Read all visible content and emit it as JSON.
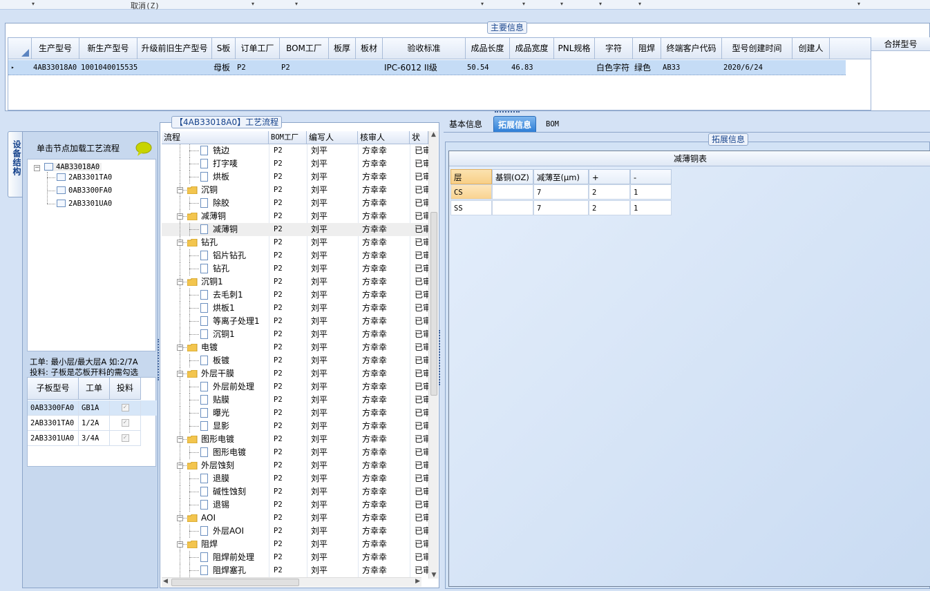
{
  "toolbar": {
    "cancel_label": "取消(Z)"
  },
  "main_info": {
    "title": "主要信息",
    "columns": [
      "生产型号",
      "新生产型号",
      "升级前旧生产型号",
      "S板",
      "订单工厂",
      "BOM工厂",
      "板厚",
      "板材",
      "验收标准",
      "成品长度",
      "成品宽度",
      "PNL规格",
      "字符",
      "阻焊",
      "终端客户代码",
      "型号创建时间",
      "创建人"
    ],
    "row": {
      "indicator": "▸",
      "cells": [
        "4AB33018A0",
        "10010400155354",
        "",
        "母板",
        "P2",
        "P2",
        "",
        "",
        "IPC-6012 II级",
        "50.54",
        "46.83",
        "",
        "白色字符",
        "绿色",
        "AB33",
        "2020/6/24",
        ""
      ]
    },
    "merge_header": "合拼型号"
  },
  "side_tab": {
    "label": "设备结构"
  },
  "left_panel": {
    "load_hint": "单击节点加载工艺流程",
    "tree": {
      "root": "4AB33018A0",
      "children": [
        "2AB3301TA0",
        "0AB3300FA0",
        "2AB3301UA0"
      ]
    },
    "note_line1": "工单: 最小层/最大层A 如:2/7A",
    "note_line2": "投料: 子板是芯板开料的需勾选",
    "sub_grid": {
      "headers": [
        "子板型号",
        "工单",
        "投料"
      ],
      "rows": [
        {
          "model": "0AB3300FA0",
          "order": "GB1A",
          "feed": "✓"
        },
        {
          "model": "2AB3301TA0",
          "order": "1/2A",
          "feed": "✓"
        },
        {
          "model": "2AB3301UA0",
          "order": "3/4A",
          "feed": "✓"
        }
      ]
    }
  },
  "flow": {
    "title": "【4AB33018A0】工艺流程",
    "headers": [
      "流程",
      "BOM工厂",
      "编写人",
      "核审人",
      "状"
    ],
    "rows": [
      {
        "name": "铣边",
        "level": 1,
        "factory": "P2",
        "writer": "刘平",
        "reviewer": "方幸幸",
        "status": "已审"
      },
      {
        "name": "打字唛",
        "level": 1,
        "factory": "P2",
        "writer": "刘平",
        "reviewer": "方幸幸",
        "status": "已审"
      },
      {
        "name": "烘板",
        "level": 1,
        "factory": "P2",
        "writer": "刘平",
        "reviewer": "方幸幸",
        "status": "已审"
      },
      {
        "name": "沉铜",
        "level": 0,
        "factory": "P2",
        "writer": "刘平",
        "reviewer": "方幸幸",
        "status": "已审"
      },
      {
        "name": "除胶",
        "level": 1,
        "factory": "P2",
        "writer": "刘平",
        "reviewer": "方幸幸",
        "status": "已审"
      },
      {
        "name": "减薄铜",
        "level": 0,
        "factory": "P2",
        "writer": "刘平",
        "reviewer": "方幸幸",
        "status": "已审"
      },
      {
        "name": "减薄铜",
        "level": 1,
        "factory": "P2",
        "writer": "刘平",
        "reviewer": "方幸幸",
        "status": "已审",
        "selected": true
      },
      {
        "name": "钻孔",
        "level": 0,
        "factory": "P2",
        "writer": "刘平",
        "reviewer": "方幸幸",
        "status": "已审"
      },
      {
        "name": "铝片钻孔",
        "level": 1,
        "factory": "P2",
        "writer": "刘平",
        "reviewer": "方幸幸",
        "status": "已审"
      },
      {
        "name": "钻孔",
        "level": 1,
        "factory": "P2",
        "writer": "刘平",
        "reviewer": "方幸幸",
        "status": "已审"
      },
      {
        "name": "沉铜1",
        "level": 0,
        "factory": "P2",
        "writer": "刘平",
        "reviewer": "方幸幸",
        "status": "已审"
      },
      {
        "name": "去毛刺1",
        "level": 1,
        "factory": "P2",
        "writer": "刘平",
        "reviewer": "方幸幸",
        "status": "已审"
      },
      {
        "name": "烘板1",
        "level": 1,
        "factory": "P2",
        "writer": "刘平",
        "reviewer": "方幸幸",
        "status": "已审"
      },
      {
        "name": "等离子处理1",
        "level": 1,
        "factory": "P2",
        "writer": "刘平",
        "reviewer": "方幸幸",
        "status": "已审"
      },
      {
        "name": "沉铜1",
        "level": 1,
        "factory": "P2",
        "writer": "刘平",
        "reviewer": "方幸幸",
        "status": "已审"
      },
      {
        "name": "电镀",
        "level": 0,
        "factory": "P2",
        "writer": "刘平",
        "reviewer": "方幸幸",
        "status": "已审"
      },
      {
        "name": "板镀",
        "level": 1,
        "factory": "P2",
        "writer": "刘平",
        "reviewer": "方幸幸",
        "status": "已审"
      },
      {
        "name": "外层干膜",
        "level": 0,
        "factory": "P2",
        "writer": "刘平",
        "reviewer": "方幸幸",
        "status": "已审"
      },
      {
        "name": "外层前处理",
        "level": 1,
        "factory": "P2",
        "writer": "刘平",
        "reviewer": "方幸幸",
        "status": "已审"
      },
      {
        "name": "贴膜",
        "level": 1,
        "factory": "P2",
        "writer": "刘平",
        "reviewer": "方幸幸",
        "status": "已审"
      },
      {
        "name": "曝光",
        "level": 1,
        "factory": "P2",
        "writer": "刘平",
        "reviewer": "方幸幸",
        "status": "已审"
      },
      {
        "name": "显影",
        "level": 1,
        "factory": "P2",
        "writer": "刘平",
        "reviewer": "方幸幸",
        "status": "已审"
      },
      {
        "name": "图形电镀",
        "level": 0,
        "factory": "P2",
        "writer": "刘平",
        "reviewer": "方幸幸",
        "status": "已审"
      },
      {
        "name": "图形电镀",
        "level": 1,
        "factory": "P2",
        "writer": "刘平",
        "reviewer": "方幸幸",
        "status": "已审"
      },
      {
        "name": "外层蚀刻",
        "level": 0,
        "factory": "P2",
        "writer": "刘平",
        "reviewer": "方幸幸",
        "status": "已审"
      },
      {
        "name": "退膜",
        "level": 1,
        "factory": "P2",
        "writer": "刘平",
        "reviewer": "方幸幸",
        "status": "已审"
      },
      {
        "name": "碱性蚀刻",
        "level": 1,
        "factory": "P2",
        "writer": "刘平",
        "reviewer": "方幸幸",
        "status": "已审"
      },
      {
        "name": "退锡",
        "level": 1,
        "factory": "P2",
        "writer": "刘平",
        "reviewer": "方幸幸",
        "status": "已审"
      },
      {
        "name": "AOI",
        "level": 0,
        "factory": "P2",
        "writer": "刘平",
        "reviewer": "方幸幸",
        "status": "已审"
      },
      {
        "name": "外层AOI",
        "level": 1,
        "factory": "P2",
        "writer": "刘平",
        "reviewer": "方幸幸",
        "status": "已审"
      },
      {
        "name": "阻焊",
        "level": 0,
        "factory": "P2",
        "writer": "刘平",
        "reviewer": "方幸幸",
        "status": "已审"
      },
      {
        "name": "阻焊前处理",
        "level": 1,
        "factory": "P2",
        "writer": "刘平",
        "reviewer": "方幸幸",
        "status": "已审"
      },
      {
        "name": "阻焊塞孔",
        "level": 1,
        "factory": "P2",
        "writer": "刘平",
        "reviewer": "方幸幸",
        "status": "已审"
      }
    ]
  },
  "tabs": {
    "items": [
      "基本信息",
      "拓展信息",
      "BOM"
    ],
    "active": "拓展信息"
  },
  "ext": {
    "title": "拓展信息",
    "table_title": "减薄铜表",
    "headers": [
      "层",
      "基铜(OZ)",
      "减薄至(μm)",
      "+",
      "-"
    ],
    "rows": [
      {
        "layer": "CS",
        "base": "",
        "thin": "7",
        "plus": "2",
        "minus": "1"
      },
      {
        "layer": "SS",
        "base": "",
        "thin": "7",
        "plus": "2",
        "minus": "1"
      }
    ]
  },
  "colors": {
    "accent": "#2e7ed6",
    "selected_row": "#c5dcf6",
    "header_orange": "#f8cf86",
    "folder": "#f3c54e"
  }
}
